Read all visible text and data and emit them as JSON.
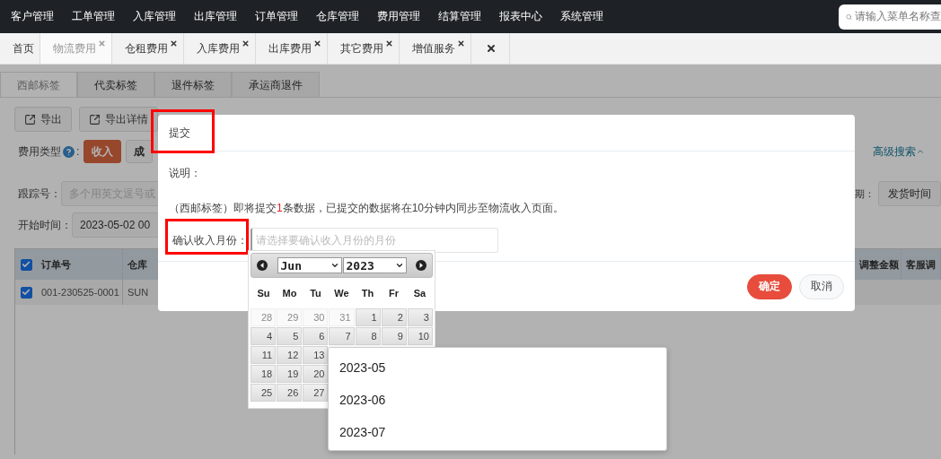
{
  "top_nav": {
    "items": [
      "客户管理",
      "工单管理",
      "入库管理",
      "出库管理",
      "订单管理",
      "仓库管理",
      "费用管理",
      "结算管理",
      "报表中心",
      "系统管理"
    ],
    "search": {
      "placeholder": "请输入菜单名称查"
    }
  },
  "page_tabs": [
    {
      "kind": "page",
      "label": "首页",
      "selected": false,
      "closable": false
    },
    {
      "kind": "page",
      "label": "物流费用",
      "selected": true,
      "closable": true
    },
    {
      "kind": "page",
      "label": "仓租费用",
      "selected": false,
      "closable": true
    },
    {
      "kind": "page",
      "label": "入库费用",
      "selected": false,
      "closable": true
    },
    {
      "kind": "page",
      "label": "出库费用",
      "selected": false,
      "closable": true
    },
    {
      "kind": "page",
      "label": "其它费用",
      "selected": false,
      "closable": true
    },
    {
      "kind": "page",
      "label": "增值服务",
      "selected": false,
      "closable": true
    },
    {
      "kind": "close_all",
      "selected": false,
      "closable": true
    }
  ],
  "sub_tabs": [
    {
      "label": "西邮标签",
      "selected": true
    },
    {
      "label": "代卖标签",
      "selected": false
    },
    {
      "label": "退件标签",
      "selected": false
    },
    {
      "label": "承运商退件",
      "selected": false
    }
  ],
  "toolbar": [
    "导出",
    "导出详情"
  ],
  "fee_type": {
    "label": "费用类型",
    "colon": ":",
    "options": [
      {
        "label": "收入",
        "selected": true
      },
      {
        "label": "成",
        "selected": false
      }
    ]
  },
  "advanced_search": "高级搜索",
  "tracking": {
    "label": "跟踪号：",
    "placeholder": "多个用英文逗号或"
  },
  "date_type": {
    "label": "期：",
    "value": "发货时间"
  },
  "start_time": {
    "label": "开始时间：",
    "value": "2023-05-02 00"
  },
  "table": {
    "all_checked": true,
    "columns": [
      "订单号",
      "仓库"
    ],
    "right_columns": [
      "调整金额",
      "客服调"
    ],
    "rows": [
      {
        "checked": true,
        "cells": [
          "001-230525-0001",
          "SUN"
        ]
      }
    ]
  },
  "modal": {
    "title": "提交",
    "title_highlighted": true,
    "note_label": "说明：",
    "message": {
      "before": "（西邮标签）即将提交",
      "count": "1",
      "after": "条数据，已提交的数据将在10分钟内同步至物流收入页面。"
    },
    "month_field": {
      "label": "确认收入月份：",
      "placeholder": "请选择要确认收入月份的月份",
      "highlighted": true
    },
    "buttons": [
      {
        "kind": "primary",
        "label": "确定"
      },
      {
        "kind": "secondary",
        "label": "取消"
      }
    ]
  },
  "datepicker": {
    "month": "Jun",
    "year": "2023",
    "weekdays": [
      "Su",
      "Mo",
      "Tu",
      "We",
      "Th",
      "Fr",
      "Sa"
    ],
    "weeks": [
      [
        {
          "day": "28",
          "other_month": true
        },
        {
          "day": "29",
          "other_month": true
        },
        {
          "day": "30",
          "other_month": true
        },
        {
          "day": "31",
          "other_month": true
        },
        {
          "day": "1",
          "other_month": false
        },
        {
          "day": "2",
          "other_month": false
        },
        {
          "day": "3",
          "other_month": false
        }
      ],
      [
        {
          "day": "4",
          "other_month": false
        },
        {
          "day": "5",
          "other_month": false
        },
        {
          "day": "6",
          "other_month": false
        },
        {
          "day": "7",
          "other_month": false
        },
        {
          "day": "8",
          "other_month": false
        },
        {
          "day": "9",
          "other_month": false
        },
        {
          "day": "10",
          "other_month": false
        }
      ],
      [
        {
          "day": "11",
          "other_month": false
        },
        {
          "day": "12",
          "other_month": false
        },
        {
          "day": "13",
          "other_month": false
        }
      ],
      [
        {
          "day": "18",
          "other_month": false
        },
        {
          "day": "19",
          "other_month": false
        },
        {
          "day": "20",
          "other_month": false
        }
      ],
      [
        {
          "day": "25",
          "other_month": false
        },
        {
          "day": "26",
          "other_month": false
        },
        {
          "day": "27",
          "other_month": false
        }
      ]
    ]
  },
  "month_options": [
    "2023-05",
    "2023-06",
    "2023-07"
  ]
}
